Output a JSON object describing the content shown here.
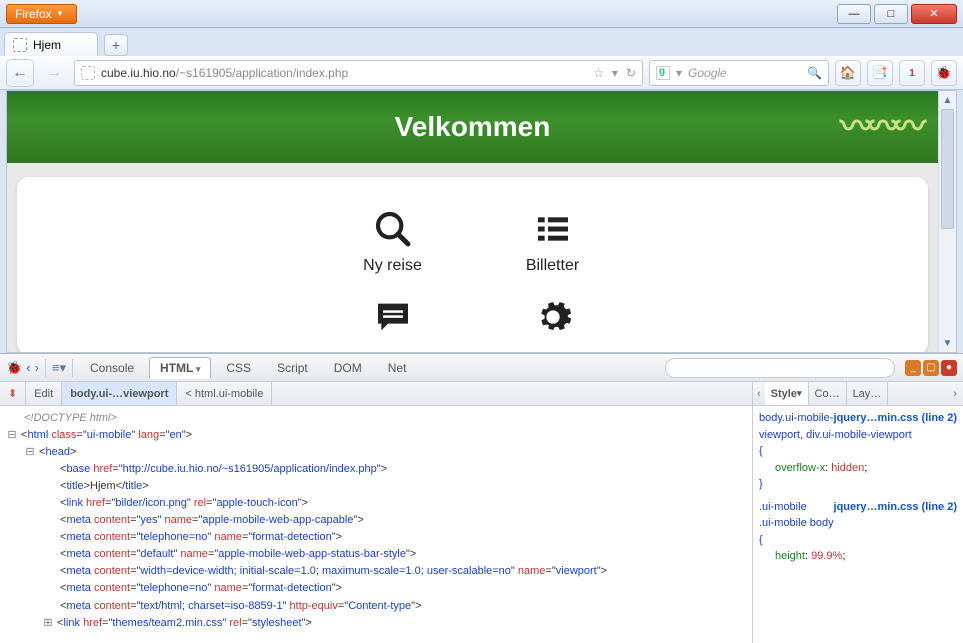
{
  "window": {
    "firefox_label": "Firefox",
    "tab_title": "Hjem",
    "newtab": "+"
  },
  "nav": {
    "url_domain": "cube.iu.hio.no",
    "url_prefix": "",
    "url_path": "/~s161905/application/index.php",
    "search_placeholder": "Google",
    "star": "☆",
    "dropdown": "▾",
    "refresh": "↻"
  },
  "page": {
    "header_title": "Velkommen",
    "items": [
      {
        "label": "Ny reise",
        "icon": "search"
      },
      {
        "label": "Billetter",
        "icon": "list"
      },
      {
        "label": "",
        "icon": "chat"
      },
      {
        "label": "",
        "icon": "gear"
      }
    ]
  },
  "firebug": {
    "tabs": [
      "Console",
      "HTML",
      "CSS",
      "Script",
      "DOM",
      "Net"
    ],
    "active_tab": "HTML",
    "crumb_edit": "Edit",
    "crumb_active": "body.ui-…viewport",
    "crumb_parent": "html.ui-mobile",
    "lt": "<",
    "right_tabs": [
      "Style",
      "Co…",
      "Lay…"
    ],
    "html": {
      "doctype": "<!DOCTYPE html>",
      "html_open_a": "html",
      "html_class": "ui-mobile",
      "html_lang": "en",
      "head": "head",
      "base_href": "http://cube.iu.hio.no/~s161905/application/index.php",
      "title_tag": "title",
      "title_text": "Hjem",
      "link1_href": "bilder/icon.png",
      "link1_rel": "apple-touch-icon",
      "meta1_content": "yes",
      "meta1_name": "apple-mobile-web-app-capable",
      "meta2_content": "telephone=no",
      "meta2_name": "format-detection",
      "meta3_content": "default",
      "meta3_name": "apple-mobile-web-app-status-bar-style",
      "meta4_content": "width=device-width; initial-scale=1.0; maximum-scale=1.0; user-scalable=no",
      "meta4_name": "viewport",
      "meta5_content": "telephone=no",
      "meta5_name": "format-detection",
      "meta6_content": "text/html; charset=iso-8859-1",
      "meta6_httpequiv": "Content-type",
      "link2_href": "themes/team2.min.css",
      "link2_rel": "stylesheet"
    },
    "css": {
      "src1": "jquery…min.css (line 2)",
      "sel1": "body.ui-mobile-viewport, div.ui-mobile-viewport",
      "rule1_prop": "overflow-x",
      "rule1_val": "hidden",
      "src2": "jquery…min.css (line 2)",
      "sel2a": ".ui-mobile",
      "sel2b": ".ui-mobile body",
      "rule2_prop": "height",
      "rule2_val": "99.9%"
    }
  }
}
